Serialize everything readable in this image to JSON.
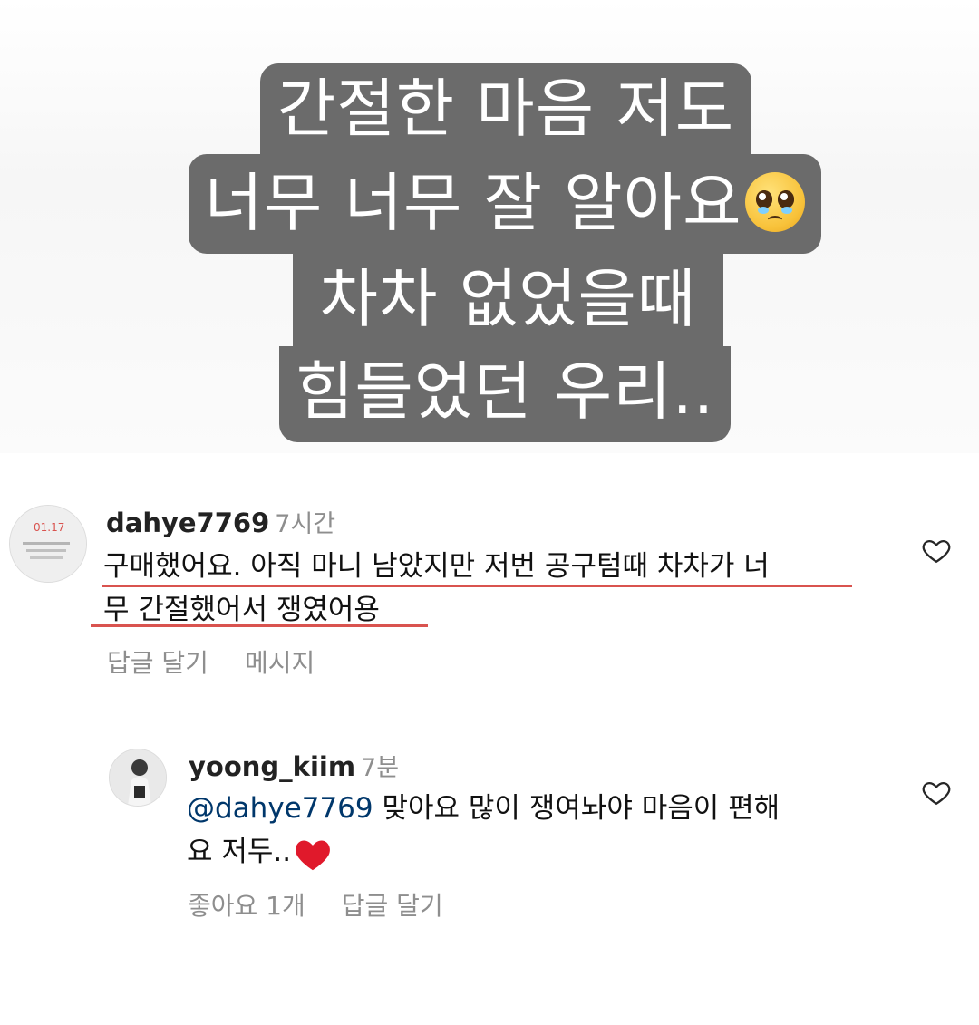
{
  "story": {
    "lines": [
      "간절한 마음 저도",
      "너무 너무 잘 알아요",
      "차차 없었을때",
      "힘들었던 우리.."
    ],
    "emoji": "pleading-face"
  },
  "comments": [
    {
      "username": "dahye7769",
      "time": "7시간",
      "text_line1": "구매했어요. 아직 마니 남았지만 저번 공구텀때 차차가 너",
      "text_line2": "무 간절했어서 쟁였어용",
      "reply_label": "답글 달기",
      "message_label": "메시지",
      "avatar_date": "01.17"
    },
    {
      "username": "yoong_kiim",
      "time": "7분",
      "mention": "@dahye7769",
      "text_line1": "맞아요 많이 쟁여놔야 마음이 편해",
      "text_line2": "요 저두..",
      "likes_label": "좋아요 1개",
      "reply_label": "답글 달기"
    }
  ],
  "colors": {
    "story_bg": "#6b6b6b",
    "underline": "#d9534f",
    "mention": "#00376b",
    "muted": "#8e8e8e"
  }
}
